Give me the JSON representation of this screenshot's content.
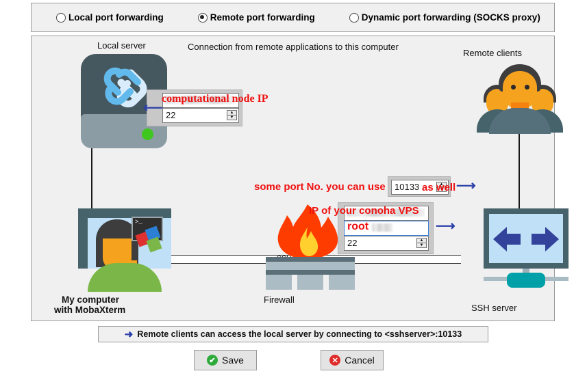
{
  "mode_selector": {
    "options": [
      {
        "label": "Local port forwarding",
        "selected": false
      },
      {
        "label": "Remote port forwarding",
        "selected": true
      },
      {
        "label": "Dynamic port forwarding (SOCKS proxy)",
        "selected": false
      }
    ]
  },
  "diagram": {
    "caption": "Connection from remote applications to this computer",
    "local_server_label": "Local server",
    "remote_clients_label": "Remote clients",
    "my_computer_label_line1": "My computer",
    "my_computer_label_line2": "with MobaXterm",
    "firewall_label": "Firewall",
    "ssh_tunnel_label": "SSH tunnel",
    "ssh_server_label": "SSH server",
    "terminal_prompt": ">_"
  },
  "forward_fields": {
    "local_target": {
      "host_value": "",
      "host_annotation": "computational node IP",
      "port_value": "22"
    },
    "remote_port": {
      "value": "10133",
      "annotation": "as well"
    },
    "remote_port_annotation_prefix": "some port No. you can use",
    "ssh_server": {
      "host_value": "",
      "host_annotation": "IP of your conoha VPS",
      "user_value": "",
      "user_annotation": "root",
      "port_value": "22"
    }
  },
  "status": {
    "arrow": "➜",
    "text": "Remote clients can access the local server by connecting to <sshserver>:10133"
  },
  "buttons": {
    "save": "Save",
    "cancel": "Cancel",
    "save_icon": "✔",
    "cancel_icon": "✕"
  },
  "colors": {
    "panel_bg": "#f0f0f0",
    "accent_blue": "#2b3fa8",
    "annotation_red": "#f01010",
    "server_dark": "#46585f",
    "server_light": "#8c9ca4",
    "led_green": "#3fc61f",
    "teal": "#00a0a8",
    "flame_orange": "#ff3c00",
    "flame_yellow": "#ffd02e"
  }
}
